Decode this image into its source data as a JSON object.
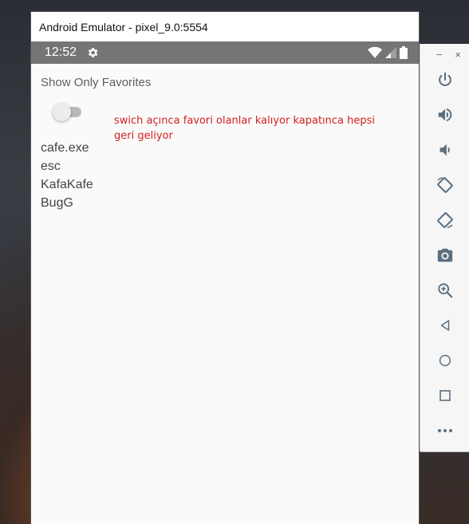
{
  "window": {
    "title": "Android Emulator - pixel_9.0:5554"
  },
  "status_bar": {
    "time": "12:52"
  },
  "app": {
    "favorites_label": "Show Only Favorites",
    "switch_on": false,
    "note": "swich açınca favori olanlar kalıyor kapatınca hepsi geri geliyor",
    "items": [
      "cafe.exe",
      "esc",
      "KafaKafe",
      "BugG"
    ]
  },
  "toolbar": {
    "minimize": "−",
    "close": "×",
    "buttons": [
      "power-icon",
      "volume-up-icon",
      "volume-down-icon",
      "rotate-left-icon",
      "rotate-right-icon",
      "camera-icon",
      "zoom-icon",
      "back-icon",
      "home-icon",
      "overview-icon",
      "more-icon"
    ]
  },
  "colors": {
    "status_bar": "#757575",
    "note_text": "#d42020",
    "toolbar_icon": "#5b6f80"
  }
}
